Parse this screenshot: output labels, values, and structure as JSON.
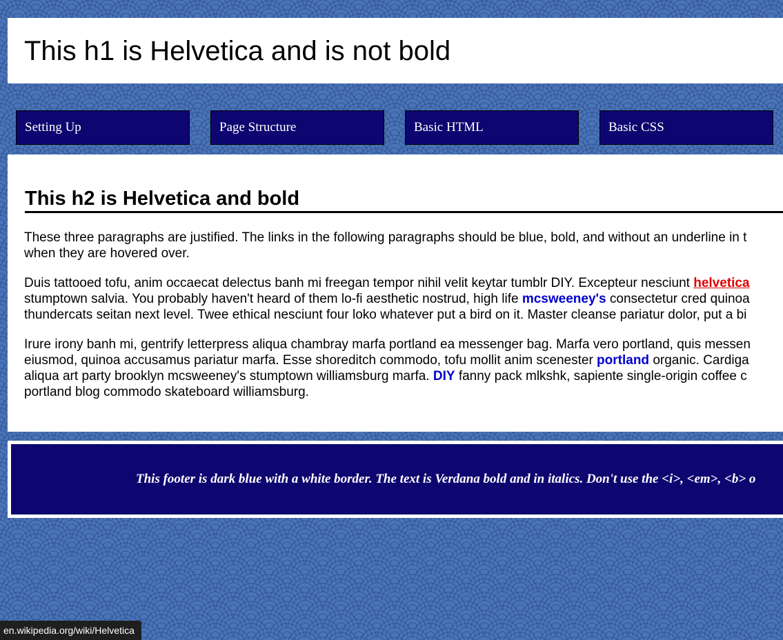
{
  "header": {
    "title": "This h1 is Helvetica and is not bold"
  },
  "nav": {
    "items": [
      {
        "label": "Setting Up"
      },
      {
        "label": "Page Structure"
      },
      {
        "label": "Basic HTML"
      },
      {
        "label": "Basic CSS"
      }
    ]
  },
  "main": {
    "heading": "This h2 is Helvetica and bold",
    "p1": {
      "line1": "These three paragraphs are justified. The links in the following paragraphs should be blue, bold, and without an underline in t",
      "line2": "when they are hovered over."
    },
    "p2": {
      "line1_a": "Duis tattooed tofu, anim occaecat delectus banh mi freegan tempor nihil velit keytar tumblr DIY. Excepteur nesciunt ",
      "link_helvetica": "helvetica",
      "line2_a": "stumptown salvia. You probably haven't heard of them lo-fi aesthetic nostrud, high life ",
      "link_mcsweeneys": "mcsweeney's",
      "line2_b": " consectetur cred quinoa",
      "line3": "thundercats seitan next level. Twee ethical nesciunt four loko whatever put a bird on it. Master cleanse pariatur dolor, put a bi"
    },
    "p3": {
      "line1": "Irure irony banh mi, gentrify letterpress aliqua chambray marfa portland ea messenger bag. Marfa vero portland, quis messen",
      "line2_a": "eiusmod, quinoa accusamus pariatur marfa. Esse shoreditch commodo, tofu mollit anim scenester ",
      "link_portland": "portland",
      "line2_b": " organic. Cardiga",
      "line3_a": "aliqua art party brooklyn mcsweeney's stumptown williamsburg marfa. ",
      "link_diy": "DIY",
      "line3_b": " fanny pack mlkshk, sapiente single-origin coffee c",
      "line4": "portland blog commodo skateboard williamsburg."
    }
  },
  "footer": {
    "text": "This footer is dark blue with a white border. The text is Verdana bold and in italics. Don't use the <i>, <em>, <b> o"
  },
  "status_bar": {
    "url": "en.wikipedia.org/wiki/Helvetica"
  },
  "colors": {
    "background": "#4a74b8",
    "nav_bg": "#0d0670",
    "footer_bg": "#0d0670",
    "link": "#0000cc",
    "link_hover": "#dd0000"
  }
}
